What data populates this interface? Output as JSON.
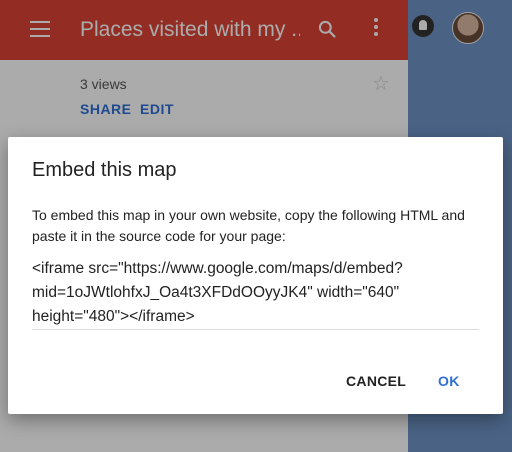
{
  "app": {
    "title": "Places visited with my ...",
    "views": "3 views",
    "share_label": "SHARE",
    "edit_label": "EDIT",
    "header_color": "#db4437"
  },
  "dialog": {
    "title": "Embed this map",
    "description": "To embed this map in your own website, copy the following HTML and paste it in the source code for your page:",
    "code": "<iframe src=\"https://www.google.com/maps/d/embed?mid=1oJWtlohfxJ_Oa4t3XFDdOOyyJK4\" width=\"640\" height=\"480\"></iframe>",
    "cancel_label": "CANCEL",
    "ok_label": "OK",
    "accent_color": "#2f6fd6"
  },
  "icons": [
    "menu-icon",
    "search-icon",
    "more-vert-icon",
    "notification-icon",
    "avatar",
    "star-icon"
  ]
}
